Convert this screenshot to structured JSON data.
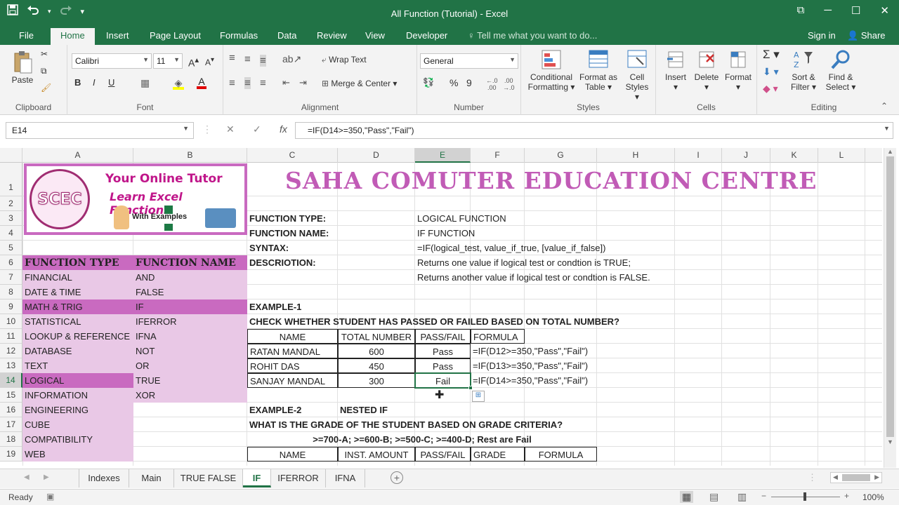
{
  "window": {
    "title": "All Function (Tutorial) - Excel"
  },
  "qat": {
    "save_icon": "save-icon",
    "undo_icon": "undo-icon",
    "redo_icon": "redo-icon"
  },
  "tabs": [
    "File",
    "Home",
    "Insert",
    "Page Layout",
    "Formulas",
    "Data",
    "Review",
    "View",
    "Developer"
  ],
  "tell_me": "Tell me what you want to do...",
  "sign_in": "Sign in",
  "share": "Share",
  "ribbon": {
    "clipboard": {
      "paste": "Paste",
      "label": "Clipboard"
    },
    "font": {
      "name": "Calibri",
      "size": "11",
      "label": "Font",
      "bold": "B",
      "italic": "I",
      "underline": "U"
    },
    "alignment": {
      "wrap": "Wrap Text",
      "merge": "Merge & Center",
      "label": "Alignment"
    },
    "number": {
      "format": "General",
      "label": "Number",
      "percent": "%",
      "comma": "9"
    },
    "styles": {
      "conditional": "Conditional",
      "conditional2": "Formatting",
      "format_as": "Format as",
      "format_as2": "Table",
      "cell": "Cell",
      "cell2": "Styles",
      "label": "Styles"
    },
    "cells": {
      "insert": "Insert",
      "delete": "Delete",
      "format": "Format",
      "label": "Cells"
    },
    "editing": {
      "sort": "Sort &",
      "sort2": "Filter",
      "find": "Find &",
      "find2": "Select",
      "label": "Editing"
    }
  },
  "formula_bar": {
    "name_box": "E14",
    "formula": "=IF(D14>=350,\"Pass\",\"Fail\")"
  },
  "columns": [
    "A",
    "B",
    "C",
    "D",
    "E",
    "F",
    "G",
    "H",
    "I",
    "J",
    "K",
    "L"
  ],
  "rows": [
    "1",
    "2",
    "3",
    "4",
    "5",
    "6",
    "7",
    "8",
    "9",
    "10",
    "11",
    "12",
    "13",
    "14",
    "15",
    "16",
    "17",
    "18",
    "19"
  ],
  "banner": "SAHA COMUTER EDUCATION CENTRE",
  "logo": {
    "circle": "SCEC",
    "line1": "Your Online Tutor",
    "line2": "Learn Excel Functions",
    "line3": "With Examples"
  },
  "index_table": {
    "headers": [
      "FUNCTION TYPE",
      "FUNCTION NAME"
    ],
    "types": [
      "FINANCIAL",
      "DATE & TIME",
      "MATH & TRIG",
      "STATISTICAL",
      "LOOKUP & REFERENCE",
      "DATABASE",
      "TEXT",
      "LOGICAL",
      "INFORMATION",
      "ENGINEERING",
      "CUBE",
      "COMPATIBILITY",
      "WEB"
    ],
    "names": [
      "AND",
      "FALSE",
      "IF",
      "IFERROR",
      "IFNA",
      "NOT",
      "OR",
      "TRUE",
      "XOR"
    ]
  },
  "info": {
    "type_label": "FUNCTION TYPE:",
    "type_value": "LOGICAL FUNCTION",
    "name_label": "FUNCTION NAME:",
    "name_value": "IF FUNCTION",
    "syntax_label": "SYNTAX:",
    "syntax_value": "=IF(logical_test, value_if_true, [value_if_false])",
    "desc_label": "DESCRIOTION:",
    "desc_value1": "Returns one value if logical test or condtion is TRUE;",
    "desc_value2": "Returns another value if logical test or condtion is FALSE."
  },
  "example1": {
    "title": "EXAMPLE-1",
    "question": "CHECK WHETHER STUDENT HAS PASSED OR FAILED BASED ON TOTAL NUMBER?",
    "headers": [
      "NAME",
      "TOTAL NUMBER",
      "PASS/FAIL",
      "FORMULA"
    ],
    "rows": [
      [
        "RATAN MANDAL",
        "600",
        "Pass",
        "=IF(D12>=350,\"Pass\",\"Fail\")"
      ],
      [
        "ROHIT DAS",
        "450",
        "Pass",
        "=IF(D13>=350,\"Pass\",\"Fail\")"
      ],
      [
        "SANJAY MANDAL",
        "300",
        "Fail",
        "=IF(D14>=350,\"Pass\",\"Fail\")"
      ]
    ]
  },
  "example2": {
    "title": "EXAMPLE-2",
    "subtitle": "NESTED IF",
    "question": "WHAT IS THE GRADE OF THE STUDENT BASED ON GRADE CRITERIA?",
    "criteria": ">=700-A; >=600-B; >=500-C; >=400-D; Rest are Fail",
    "headers": [
      "NAME",
      "INST. AMOUNT",
      "PASS/FAIL",
      "GRADE",
      "FORMULA"
    ]
  },
  "sheets": [
    "Indexes",
    "Main",
    "TRUE FALSE",
    "IF",
    "IFERROR",
    "IFNA"
  ],
  "active_sheet": "IF",
  "status": {
    "ready": "Ready",
    "zoom": "100%"
  },
  "colors": {
    "excel_green": "#217346",
    "banner_pink": "#c15bb6",
    "pink_dark": "#c96ac0",
    "pink_light": "#e9c8e6"
  }
}
